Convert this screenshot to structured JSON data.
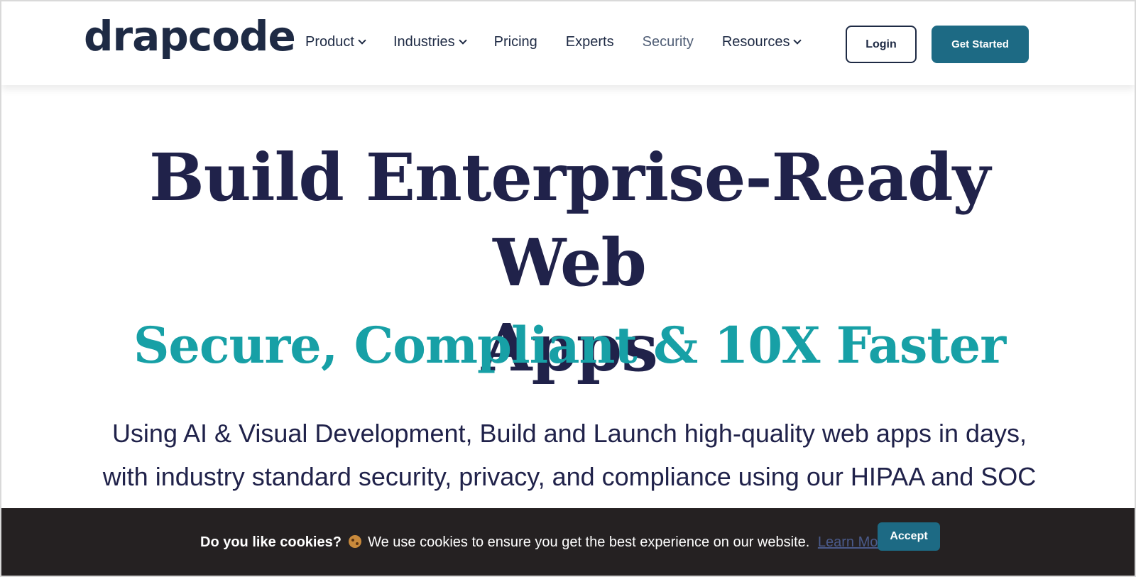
{
  "header": {
    "logo": "drapcode",
    "nav": [
      {
        "label": "Product",
        "has_dropdown": true
      },
      {
        "label": "Industries",
        "has_dropdown": true
      },
      {
        "label": "Pricing",
        "has_dropdown": false
      },
      {
        "label": "Experts",
        "has_dropdown": false
      },
      {
        "label": "Security",
        "has_dropdown": false
      },
      {
        "label": "Resources",
        "has_dropdown": true
      }
    ],
    "login_label": "Login",
    "get_started_label": "Get Started"
  },
  "hero": {
    "title_line1": "Build Enterprise-Ready Web",
    "title_line2": "Apps",
    "subtitle": "Secure, Compliant & 10X Faster",
    "description_line1": "Using AI & Visual Development, Build and Launch high-quality web apps in days,",
    "description_line2": "with industry standard security, privacy, and compliance using our HIPAA and SOC"
  },
  "cookie_bar": {
    "question": "Do you like cookies?",
    "message": "We use cookies to ensure you get the best experience on our website.",
    "learn_more": "Learn More",
    "accept_label": "Accept"
  },
  "colors": {
    "navy": "#20224a",
    "teal": "#17a0a6",
    "button": "#1d6a84",
    "cookie_bg": "#252122"
  }
}
